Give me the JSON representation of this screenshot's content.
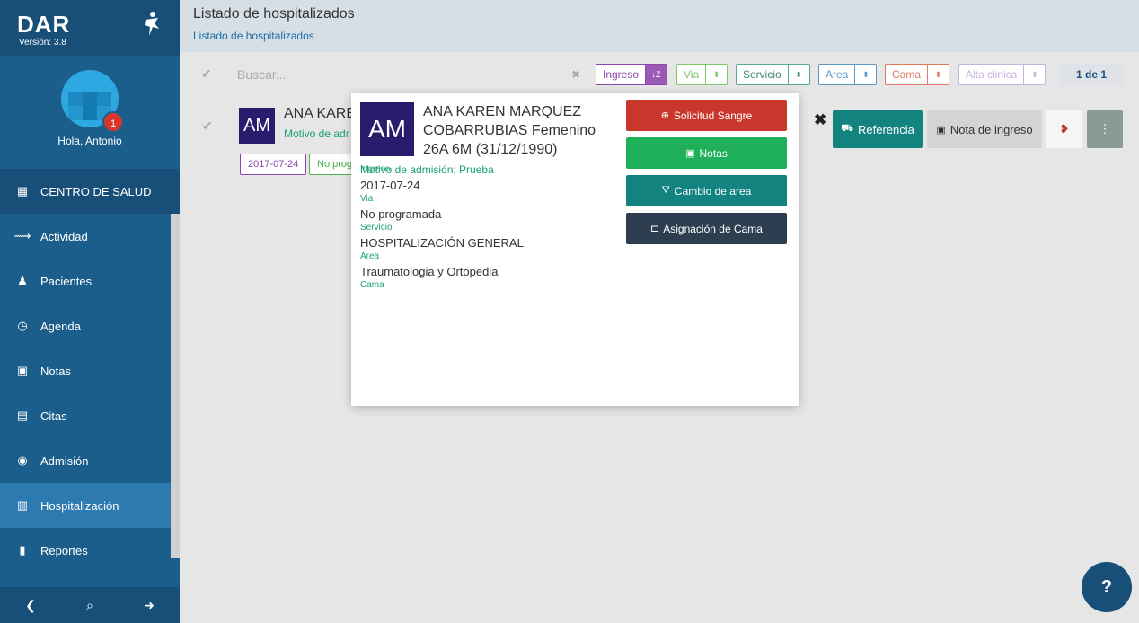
{
  "app": {
    "brand": "DAR",
    "version": "Versión: 3.8"
  },
  "sidebar": {
    "notification_count": "1",
    "greeting": "Hola, Antonio",
    "header_item": "CENTRO DE SALUD",
    "items": [
      {
        "label": "Actividad",
        "icon": "pulse-icon"
      },
      {
        "label": "Pacientes",
        "icon": "user-icon"
      },
      {
        "label": "Agenda",
        "icon": "clock-icon"
      },
      {
        "label": "Notas",
        "icon": "notes-icon"
      },
      {
        "label": "Citas",
        "icon": "calendar-icon"
      },
      {
        "label": "Admisión",
        "icon": "admission-icon"
      },
      {
        "label": "Hospitalización",
        "icon": "hospital-icon"
      },
      {
        "label": "Reportes",
        "icon": "report-icon"
      }
    ]
  },
  "header": {
    "title": "Listado de hospitalizados",
    "breadcrumb": "Listado de hospitalizados"
  },
  "toolbar": {
    "search_placeholder": "Buscar...",
    "filters": {
      "ingreso": "Ingreso",
      "via": "Via",
      "servicio": "Servicio",
      "area": "Area",
      "cama": "Cama",
      "alta": "Alta clinica"
    },
    "pager": "1 de 1"
  },
  "row": {
    "initials": "AM",
    "name": "ANA KAREN",
    "motivo": "Motivo de adr",
    "tag_date": "2017-07-24",
    "tag_via": "No prog",
    "actions": {
      "referencia": "Referencia",
      "nota_ingreso": "Nota de ingreso"
    }
  },
  "modal": {
    "initials": "AM",
    "name": "ANA KAREN MARQUEZ COBARRUBIAS Femenino 26A 6M (31/12/1990)",
    "motivo": "Motivo de admisión: Prueba",
    "ingreso_label": "Ingreso",
    "ingreso_date": "2017-07-24",
    "via_label": "Via",
    "via_value": "No programada",
    "servicio_label": "Servicio",
    "servicio_value": "HOSPITALIZACIÓN GENERAL",
    "area_label": "Area",
    "area_value": "Traumatologia y Ortopedia",
    "cama_label": "Cama",
    "buttons": {
      "sangre": "Solicitud Sangre",
      "notas": "Notas",
      "cambio_area": "Cambio de area",
      "cama": "Asignación de Cama"
    }
  },
  "colors": {
    "sidebar": "#1b5e8c",
    "sangre": "#c9372c",
    "notas": "#21b05a",
    "cambio_area": "#138380",
    "cama": "#2c3e50",
    "teal": "#1aa07a"
  },
  "help": "?"
}
